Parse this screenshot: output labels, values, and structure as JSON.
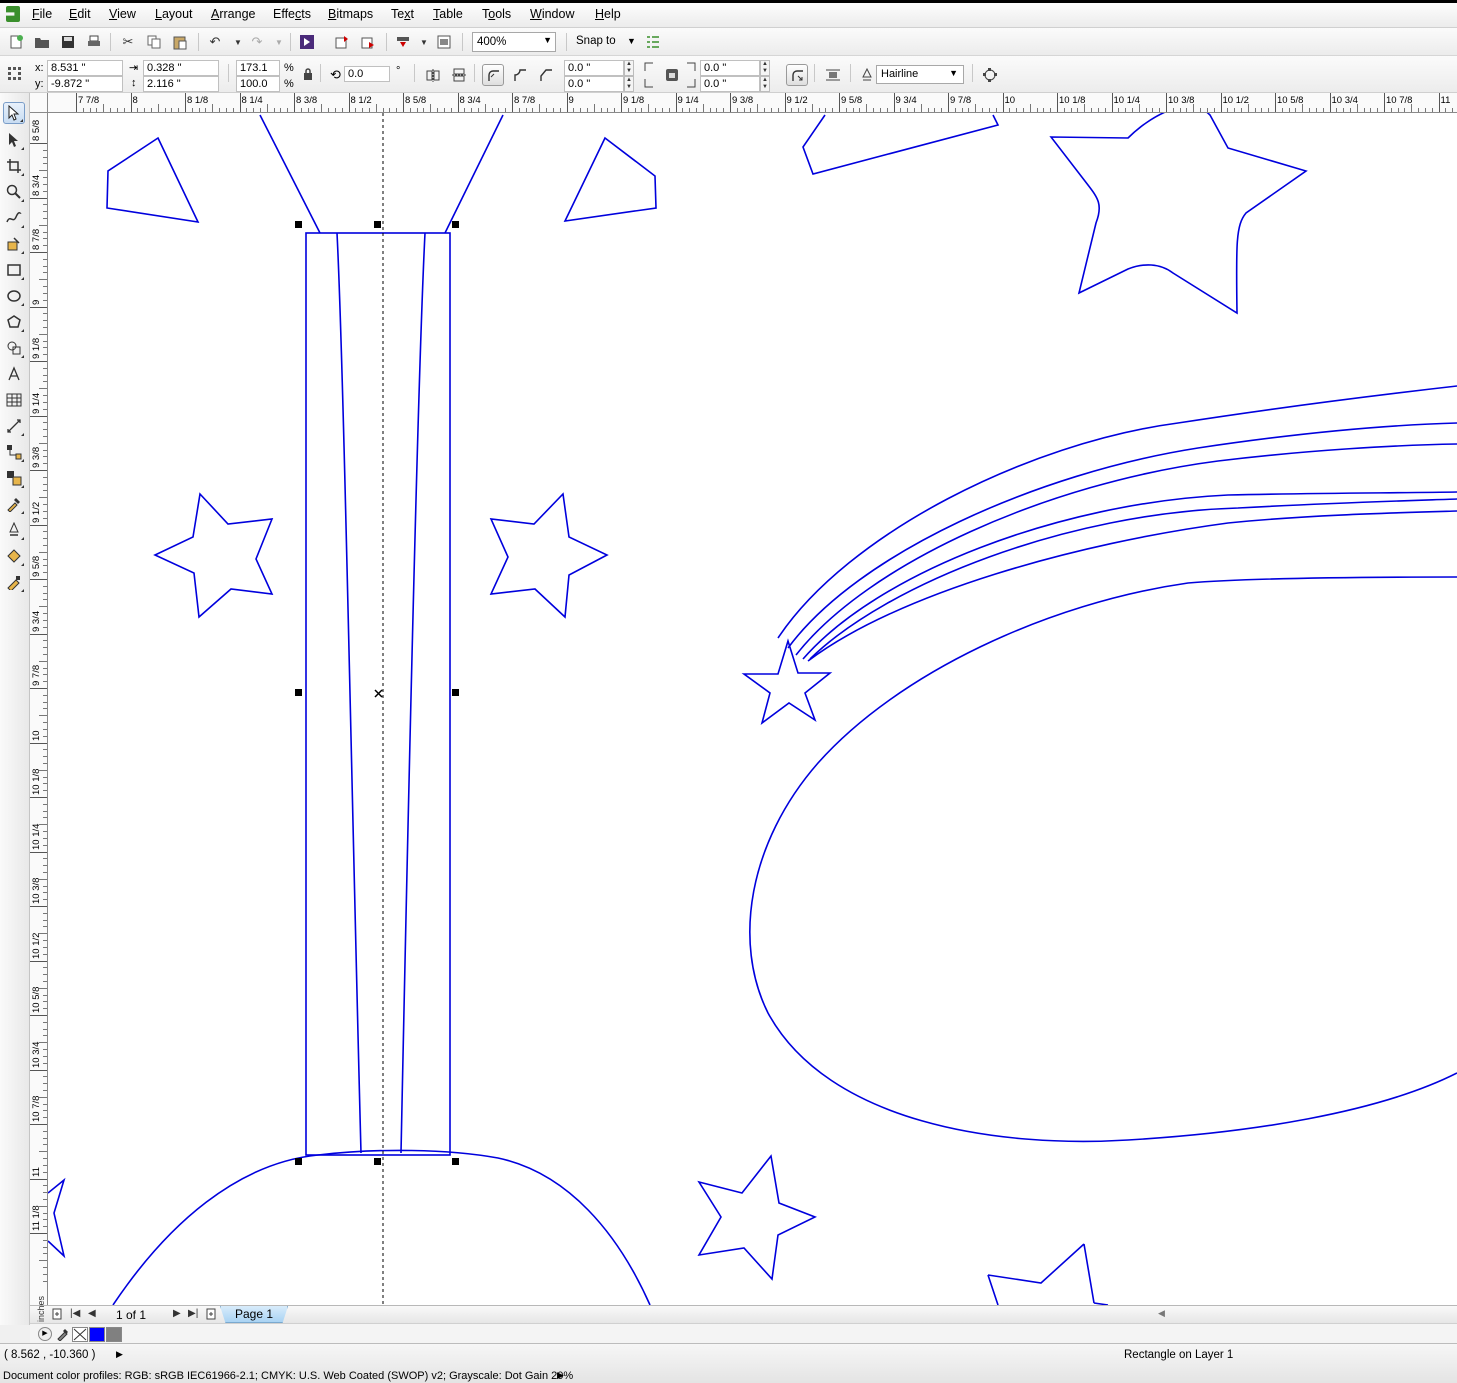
{
  "menu": [
    "File",
    "Edit",
    "View",
    "Layout",
    "Arrange",
    "Effects",
    "Bitmaps",
    "Text",
    "Table",
    "Tools",
    "Window",
    "Help"
  ],
  "menu_underline": [
    "F",
    "E",
    "V",
    "L",
    "A",
    "C",
    "B",
    "X",
    "T",
    "O",
    "W",
    "H"
  ],
  "toolbar": {
    "zoom": "400%",
    "snap_label": "Snap to"
  },
  "properties": {
    "x_label": "x:",
    "x_value": "8.531 \"",
    "y_label": "y:",
    "y_value": "-9.872 \"",
    "width_value": "0.328 \"",
    "height_value": "2.116 \"",
    "scale_x": "173.1",
    "scale_y": "100.0",
    "percent": "%",
    "rotation": "0.0",
    "degree": "°",
    "corner_tl": "0.0 \"",
    "corner_bl": "0.0 \"",
    "corner_tr": "0.0 \"",
    "corner_br": "0.0 \"",
    "outline_width": "Hairline"
  },
  "ruler_top_labels": [
    "7 7/8",
    "8",
    "8 1/8",
    "8 1/4",
    "8 3/8",
    "8 1/2",
    "8 5/8",
    "8 3/4",
    "8 7/8",
    "9",
    "9 1/8",
    "9 1/4",
    "9 3/8",
    "9 1/2",
    "9 5/8",
    "9 3/4",
    "9 7/8",
    "10",
    "10 1/8",
    "10 1/4",
    "10 3/8",
    "10 1/2",
    "10 5/8",
    "10 3/4",
    "10 7/8",
    "11"
  ],
  "ruler_left_labels": [
    "8 5/8",
    "8 3/4",
    "8 7/8",
    "9",
    "9 1/8",
    "9 1/4",
    "9 3/8",
    "9 1/2",
    "9 5/8",
    "9 3/4",
    "9 7/8",
    "10",
    "10 1/8",
    "10 1/4",
    "10 3/8",
    "10 1/2",
    "10 5/8",
    "10 3/4",
    "10 7/8",
    "11",
    "11 1/8"
  ],
  "ruler_units": "inches",
  "pagenav": {
    "page_info": "1 of 1",
    "page_tab": "Page 1"
  },
  "palette": {
    "colors": [
      "#0000ff",
      "#808080"
    ]
  },
  "status": {
    "cursor_coords": "( 8.562 , -10.360 )",
    "object_info": "Rectangle on Layer 1",
    "color_profiles": "Document color profiles: RGB: sRGB IEC61966-2.1; CMYK: U.S. Web Coated (SWOP) v2; Grayscale: Dot Gain 20%"
  },
  "colors": {
    "outline": "#0000dd",
    "selection_handle": "#000000",
    "page_tab_bg": "#a9d3f3"
  }
}
